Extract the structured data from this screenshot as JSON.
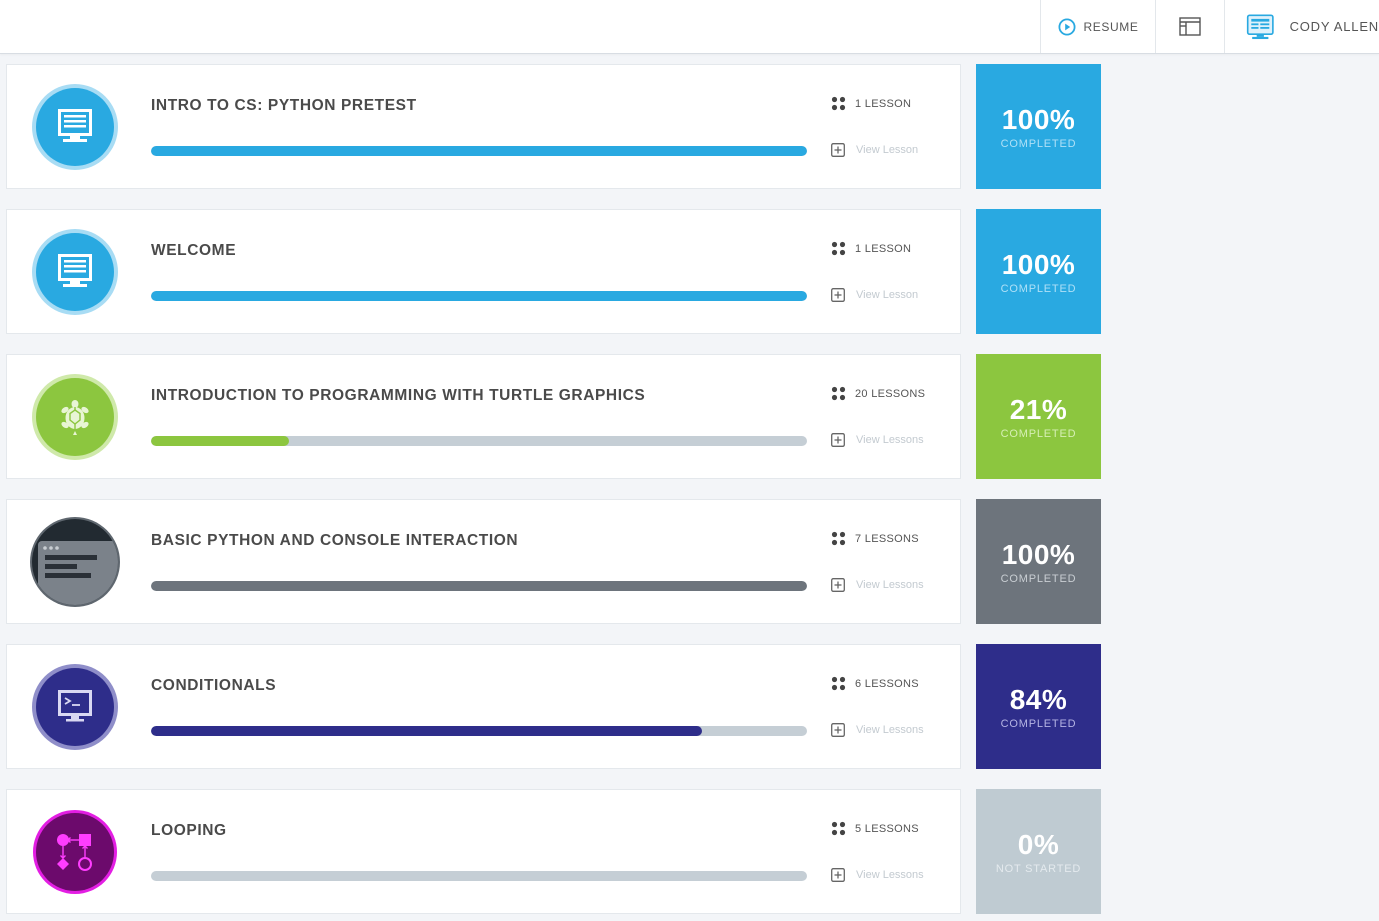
{
  "header": {
    "resume_label": "RESUME",
    "user_name": "CODY ALLEN",
    "colors": {
      "accent": "#29a9e1"
    }
  },
  "courses": [
    {
      "title": "INTRO TO CS: PYTHON PRETEST",
      "lesson_count": "1 LESSON",
      "view_label": "View Lesson",
      "percent": "100%",
      "status": "COMPLETED",
      "progress": 1.0,
      "icon": "monitor-icon",
      "color": "#29a9e1",
      "track_color": "#c5ced5",
      "status_color": "#aee0f7"
    },
    {
      "title": "WELCOME",
      "lesson_count": "1 LESSON",
      "view_label": "View Lesson",
      "percent": "100%",
      "status": "COMPLETED",
      "progress": 1.0,
      "icon": "monitor-icon",
      "color": "#29a9e1",
      "track_color": "#c5ced5",
      "status_color": "#aee0f7"
    },
    {
      "title": "INTRODUCTION TO PROGRAMMING WITH TURTLE GRAPHICS",
      "lesson_count": "20 LESSONS",
      "view_label": "View Lessons",
      "percent": "21%",
      "status": "COMPLETED",
      "progress": 0.21,
      "icon": "turtle-icon",
      "color": "#8cc63f",
      "track_color": "#c5ced5",
      "status_color": "#d6efb5"
    },
    {
      "title": "BASIC PYTHON AND CONSOLE INTERACTION",
      "lesson_count": "7 LESSONS",
      "view_label": "View Lessons",
      "percent": "100%",
      "status": "COMPLETED",
      "progress": 1.0,
      "icon": "console-window-icon",
      "color": "#6d747c",
      "track_color": "#c5ced5",
      "status_color": "#c9ced3"
    },
    {
      "title": "CONDITIONALS",
      "lesson_count": "6 LESSONS",
      "view_label": "View Lessons",
      "percent": "84%",
      "status": "COMPLETED",
      "progress": 0.84,
      "icon": "terminal-icon",
      "color": "#2e2d8a",
      "track_color": "#c5ced5",
      "status_color": "#b5b4e4"
    },
    {
      "title": "LOOPING",
      "lesson_count": "5 LESSONS",
      "view_label": "View Lessons",
      "percent": "0%",
      "status": "NOT STARTED",
      "progress": 0.0,
      "icon": "flowchart-icon",
      "color": "#bfcbd2",
      "track_color": "#c5ced5",
      "status_color": "#e4eaee"
    }
  ]
}
